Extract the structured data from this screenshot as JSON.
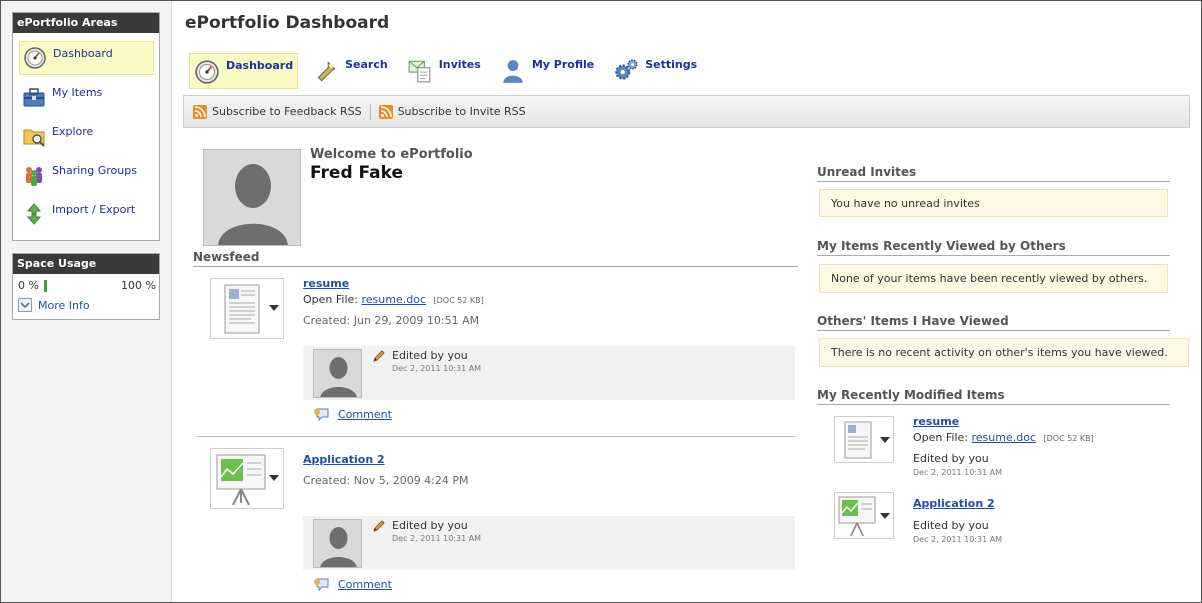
{
  "sidebar": {
    "areas_title": "ePortfolio Areas",
    "items": [
      {
        "label": "Dashboard",
        "icon": "dashboard-gauge-icon",
        "active": true
      },
      {
        "label": "My Items",
        "icon": "toolbox-icon"
      },
      {
        "label": "Explore",
        "icon": "folder-search-icon"
      },
      {
        "label": "Sharing Groups",
        "icon": "people-group-icon"
      },
      {
        "label": "Import / Export",
        "icon": "import-export-arrows-icon"
      }
    ],
    "space_title": "Space Usage",
    "space_min": "0 %",
    "space_max": "100 %",
    "space_used_fraction": 0.0,
    "more_info": "More Info"
  },
  "header": {
    "title": "ePortfolio Dashboard",
    "nav": [
      {
        "label": "Dashboard",
        "icon": "dashboard-gauge-icon",
        "active": true
      },
      {
        "label": "Search",
        "icon": "flashlight-icon"
      },
      {
        "label": "Invites",
        "icon": "envelope-doc-icon"
      },
      {
        "label": "My Profile",
        "icon": "person-silhouette-icon"
      },
      {
        "label": "Settings",
        "icon": "gears-icon"
      }
    ],
    "rss": [
      {
        "label": "Subscribe to Feedback RSS",
        "icon": "rss-icon"
      },
      {
        "label": "Subscribe to Invite RSS",
        "icon": "rss-icon"
      }
    ]
  },
  "welcome": {
    "greeting": "Welcome to ePortfolio",
    "name": "Fred Fake"
  },
  "newsfeed": {
    "title": "Newsfeed",
    "items": [
      {
        "title": "resume",
        "open_file_label": "Open File:",
        "file_name": "resume.doc",
        "file_meta": "[DOC  52 KB]",
        "created": "Created: Jun 29, 2009 10:51 AM",
        "activity": "Edited by you",
        "activity_time": "Dec 2, 2011 10:31 AM",
        "comment": "Comment"
      },
      {
        "title": "Application 2",
        "created": "Created: Nov 5, 2009 4:24 PM",
        "activity": "Edited by you",
        "activity_time": "Dec 2, 2011 10:31 AM",
        "comment": "Comment"
      }
    ]
  },
  "right": {
    "unread_title": "Unread Invites",
    "unread_msg": "You have no unread invites",
    "viewed_by_others_title": "My Items Recently Viewed by Others",
    "viewed_by_others_msg": "None of your items have been recently viewed by others.",
    "others_viewed_title": "Others' Items I Have Viewed",
    "others_viewed_msg": "There is no recent activity on other's items you have viewed.",
    "recent_title": "My Recently Modified Items",
    "recent_items": [
      {
        "title": "resume",
        "open_file_label": "Open File:",
        "file_name": "resume.doc",
        "file_meta": "[DOC  52 KB]",
        "activity": "Edited by you",
        "activity_time": "Dec 2, 2011 10:31 AM"
      },
      {
        "title": "Application 2",
        "activity": "Edited by you",
        "activity_time": "Dec 2, 2011 10:31 AM"
      }
    ]
  },
  "colors": {
    "accent_link": "#1f4fa8",
    "nav_link": "#1c2fa0",
    "active_bg": "#fafac4",
    "header_dark": "#3a3a3a",
    "notice_bg": "#fdf9e4",
    "rss_orange": "#f08a24"
  }
}
